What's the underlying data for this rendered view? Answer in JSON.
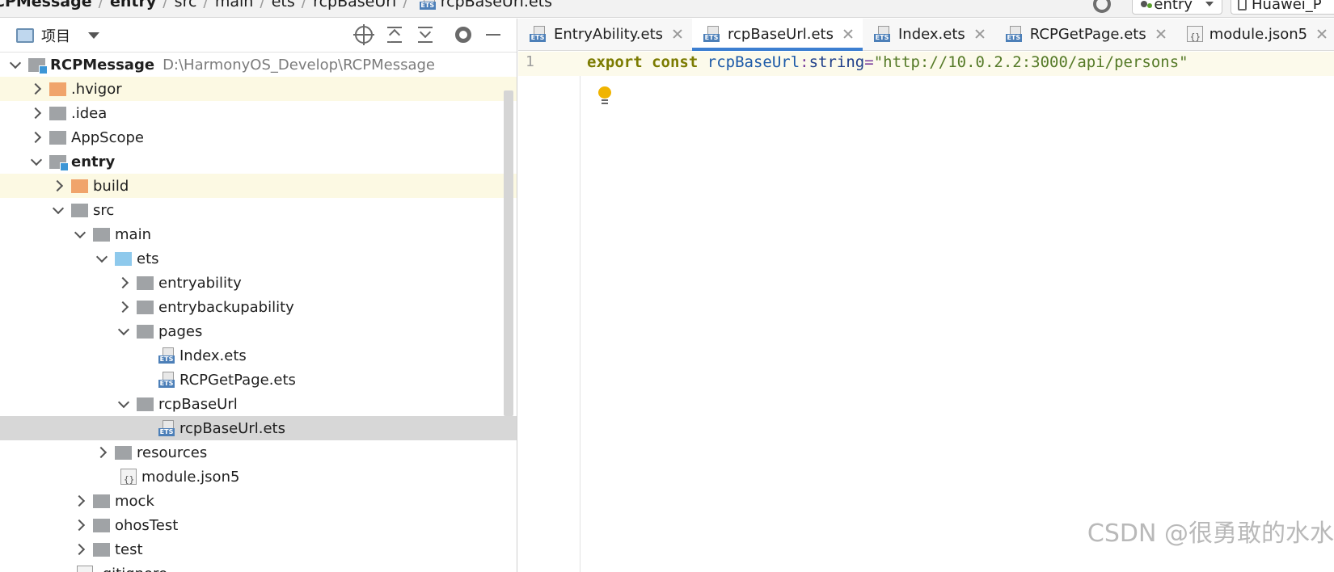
{
  "breadcrumb": {
    "items": [
      "CPMessage",
      "entry",
      "src",
      "main",
      "ets",
      "rcpBaseUrl"
    ],
    "file": "rcpBaseUrl.ets"
  },
  "toolbar": {
    "run_config": "entry",
    "device": "Huawei_P"
  },
  "project_panel": {
    "title": "项目",
    "tree": [
      {
        "label": "RCPMessage",
        "hint": "D:\\HarmonyOS_Develop\\RCPMessage"
      },
      {
        "label": ".hvigor"
      },
      {
        "label": ".idea"
      },
      {
        "label": "AppScope"
      },
      {
        "label": "entry"
      },
      {
        "label": "build"
      },
      {
        "label": "src"
      },
      {
        "label": "main"
      },
      {
        "label": "ets"
      },
      {
        "label": "entryability"
      },
      {
        "label": "entrybackupability"
      },
      {
        "label": "pages"
      },
      {
        "label": "Index.ets"
      },
      {
        "label": "RCPGetPage.ets"
      },
      {
        "label": "rcpBaseUrl"
      },
      {
        "label": "rcpBaseUrl.ets"
      },
      {
        "label": "resources"
      },
      {
        "label": "module.json5"
      },
      {
        "label": "mock"
      },
      {
        "label": "ohosTest"
      },
      {
        "label": "test"
      },
      {
        "label": ".gitignore"
      }
    ]
  },
  "editor": {
    "tabs": [
      {
        "label": "EntryAbility.ets"
      },
      {
        "label": "rcpBaseUrl.ets"
      },
      {
        "label": "Index.ets"
      },
      {
        "label": "RCPGetPage.ets"
      },
      {
        "label": "module.json5"
      }
    ],
    "line_number": "1",
    "code": {
      "kw1": "export",
      "kw2": "const",
      "ident": "rcpBaseUrl",
      "colon": ":",
      "type": "string",
      "eq": "=",
      "value": "\"http://10.0.2.2:3000/api/persons\""
    }
  },
  "ets_tag": "ETS",
  "watermark": "CSDN @很勇敢的水水",
  "colors": {
    "accent": "#3d7fd1",
    "selection": "#d7d7d7",
    "current_line": "#fcfaeb",
    "keyword": "#7b7b00",
    "string": "#557a27"
  }
}
